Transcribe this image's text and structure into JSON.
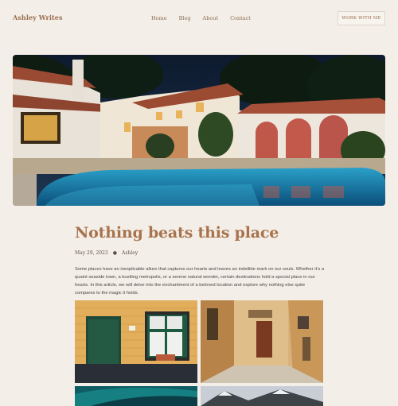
{
  "header": {
    "site_title": "Ashley Writes",
    "nav": [
      {
        "label": "Home"
      },
      {
        "label": "Blog"
      },
      {
        "label": "About"
      },
      {
        "label": "Contact"
      }
    ],
    "cta_label": "WORK WITH ME"
  },
  "post": {
    "title": "Nothing beats this place",
    "date": "May 29, 2023",
    "author": "Ashley",
    "intro": "Some places have an inexplicable allure that captures our hearts and leaves an indelible mark on our souls. Whether it’s a quaint seaside town, a bustling metropolis, or a serene natural wonder, certain destinations hold a special place in our hearts. In this article, we will delve into the enchantment of a beloved location and explore why nothing else quite compares to the magic it holds."
  },
  "colors": {
    "background": "#f3efe8",
    "accent": "#a8724d"
  }
}
